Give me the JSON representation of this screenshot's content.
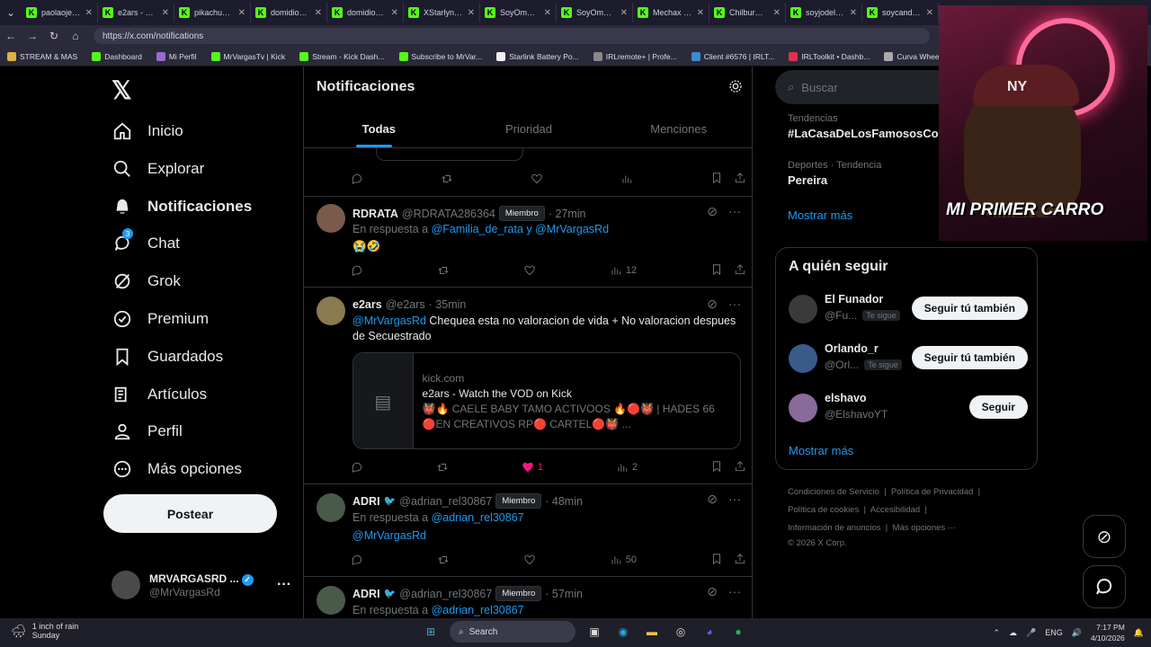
{
  "browser": {
    "tabs": [
      "paolaojedda",
      "e2ars - Watc",
      "pikachugm -",
      "domidios - V",
      "domidios - V",
      "XStarlynTA1",
      "SoyOmarTV",
      "SoyOmarTV",
      "Mechax - Wa",
      "ChilburCoC -",
      "soyjodelrd -",
      "soycande30 -"
    ],
    "url": "https://x.com/notifications",
    "bookmarks": [
      "STREAM & MAS",
      "Dashboard",
      "Mi Perfil",
      "MrVargasTv | Kick",
      "Stream - Kick Dash...",
      "Subscribe to MrVar...",
      "Starlink Battery Po...",
      "IRLremote+ | Profe...",
      "Client #6576 | IRLT...",
      "IRLToolkit • Dashb...",
      "Curva Wheels CFF76"
    ]
  },
  "leftnav": {
    "items": [
      "Inicio",
      "Explorar",
      "Notificaciones",
      "Chat",
      "Grok",
      "Premium",
      "Guardados",
      "Artículos",
      "Perfil",
      "Más opciones"
    ],
    "chat_badge": "3",
    "post_button": "Postear",
    "account": {
      "name": "MRVARGASRD ...",
      "handle": "@MrVargasRd",
      "more": "···"
    }
  },
  "main": {
    "title": "Notificaciones",
    "tabs": [
      "Todas",
      "Prioridad",
      "Menciones"
    ],
    "posts": [
      {
        "name": "RDRATA",
        "handle": "@RDRATA286364",
        "badge": "Miembro",
        "time": "· 27min",
        "reply_prefix": "En respuesta a",
        "reply_to": "@Familia_de_rata y @MrVargasRd",
        "text": "😭🤣",
        "views": "12"
      },
      {
        "name": "e2ars",
        "handle": "@e2ars",
        "time": "· 35min",
        "mention": "@MrVargasRd",
        "text": "Chequea esta no valoracion de vida + No valoracion despues de Secuestrado",
        "card": {
          "domain": "kick.com",
          "title": "e2ars - Watch the VOD on Kick",
          "desc": "👹🔥 CAELE BABY TAMO ACTIVOOS 🔥🔴👹 | HADES 66 🔴EN CREATIVOS RP🔴 CARTEL🔴👹 ..."
        },
        "likes": "1",
        "views": "2"
      },
      {
        "name": "ADRI",
        "handle": "@adrian_rel30867",
        "badge": "Miembro",
        "time": "· 48min",
        "reply_prefix": "En respuesta a",
        "reply_to": "@adrian_rel30867",
        "text": "@MrVargasRd",
        "views": "50"
      },
      {
        "name": "ADRI",
        "handle": "@adrian_rel30867",
        "badge": "Miembro",
        "time": "· 57min",
        "reply_prefix": "En respuesta a",
        "reply_to": "@adrian_rel30867"
      }
    ]
  },
  "right": {
    "search_placeholder": "Buscar",
    "trends": [
      {
        "category": "Tendencias",
        "name": "#LaCasaDeLosFamososCol"
      },
      {
        "category": "Deportes · Tendencia",
        "name": "Pereira"
      }
    ],
    "show_more": "Mostrar más",
    "follow_title": "A quién seguir",
    "follow": [
      {
        "name": "El Funador",
        "handle": "@Fu...",
        "tag": "Te sigue",
        "button": "Seguir tú también"
      },
      {
        "name": "Orlando_r",
        "handle": "@Orl...",
        "tag": "Te sigue",
        "button": "Seguir tú también"
      },
      {
        "name": "elshavo",
        "handle": "@ElshavoYT",
        "tag": "",
        "button": "Seguir"
      }
    ],
    "follow_more": "Mostrar más",
    "footer": [
      "Condiciones de Servicio",
      "|",
      "Política de Privacidad",
      "|",
      "Política de cookies",
      "|",
      "Accesibilidad",
      "|",
      "Información de anuncios",
      "|",
      "Más opciones ···",
      "© 2026 X Corp."
    ]
  },
  "overlay": {
    "camera_text": "MI PRIMER CARRO",
    "cap_text": "NY"
  },
  "taskbar": {
    "weather_title": "1 inch of rain",
    "weather_sub": "Sunday",
    "search": "Search",
    "lang": "ENG",
    "time": "7:17 PM",
    "date": "4/10/2026"
  }
}
